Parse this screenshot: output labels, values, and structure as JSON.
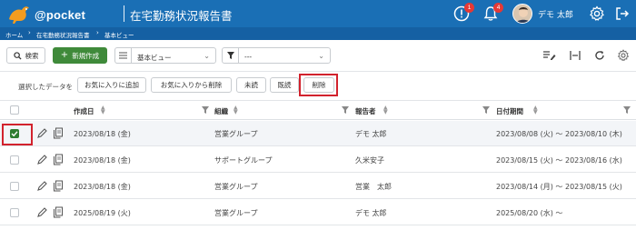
{
  "app": {
    "logo_text": "@pocket",
    "title": "在宅勤務状況報告書",
    "notification_badge": "1",
    "bell_badge": "4",
    "user_name": "デモ 太郎"
  },
  "breadcrumb": [
    "ホーム",
    "在宅勤務状況報告書",
    "基本ビュー"
  ],
  "toolbar": {
    "search_label": "検索",
    "create_label": "新規作成",
    "view_select": "基本ビュー",
    "filter_select": "---"
  },
  "actions": {
    "label": "選択したデータを",
    "buttons": [
      "お気に入りに追加",
      "お気に入りから削除",
      "未読",
      "既読",
      "削除"
    ]
  },
  "grid": {
    "columns": [
      "作成日",
      "組織",
      "報告者",
      "日付期間"
    ],
    "rows": [
      {
        "checked": true,
        "created": "2023/08/18 (金)",
        "org": "営業グループ",
        "reporter": "デモ 太郎",
        "period": "2023/08/08 (火) ～ 2023/08/10 (木)"
      },
      {
        "checked": false,
        "created": "2023/08/18 (金)",
        "org": "サポートグループ",
        "reporter": "久米安子",
        "period": "2023/08/15 (火) ～ 2023/08/16 (水)"
      },
      {
        "checked": false,
        "created": "2023/08/18 (金)",
        "org": "営業グループ",
        "reporter": "営業　太郎",
        "period": "2023/08/14 (月) ～ 2023/08/15 (火)"
      },
      {
        "checked": false,
        "created": "2025/08/19 (火)",
        "org": "営業グループ",
        "reporter": "デモ 太郎",
        "period": "2025/08/20 (水) ～"
      }
    ]
  },
  "colors": {
    "header_blue": "#1a6fb5",
    "create_green": "#3f8a3a",
    "highlight_red": "#d2222d",
    "badge_red": "#e53935"
  }
}
